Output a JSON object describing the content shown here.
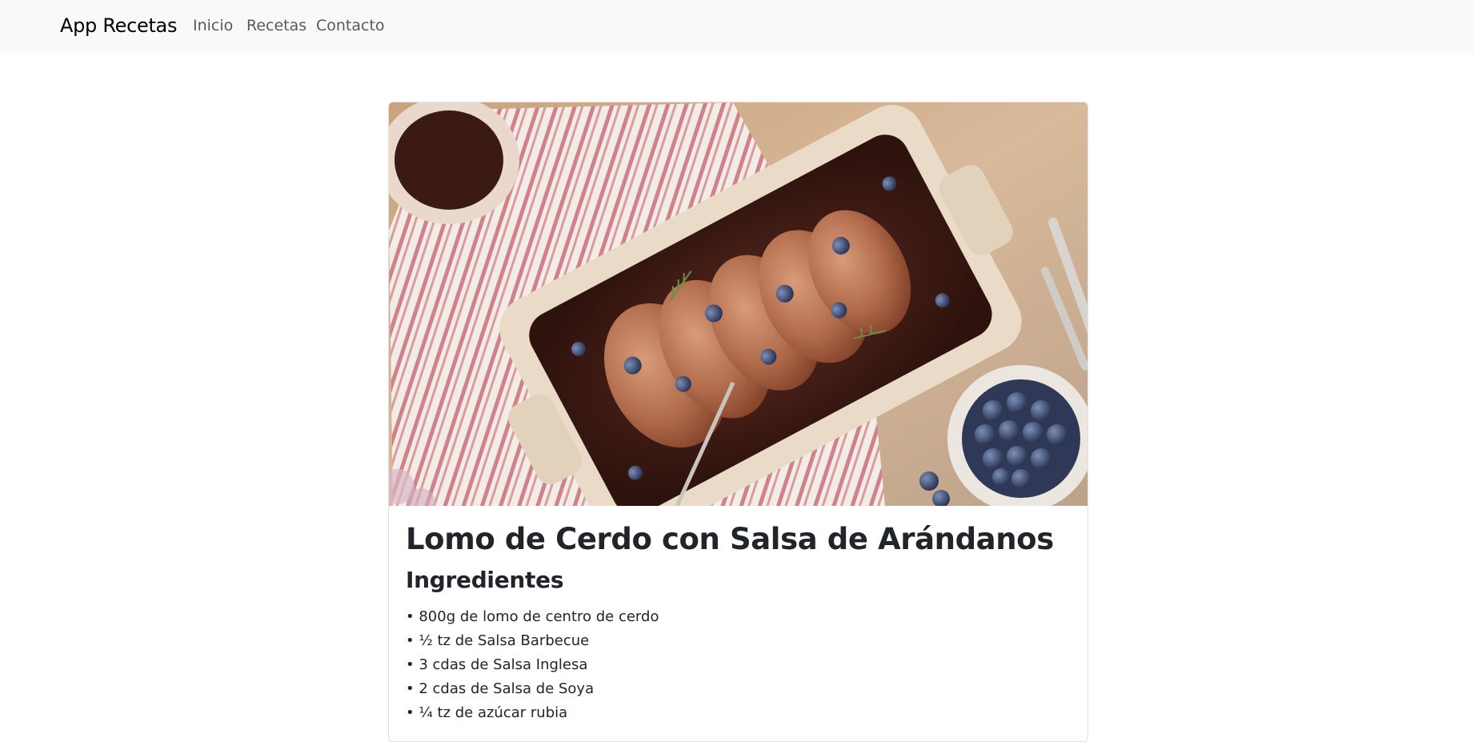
{
  "navbar": {
    "brand": "App Recetas",
    "links": [
      "Inicio",
      "Recetas",
      "Contacto"
    ]
  },
  "recipe": {
    "image_icon": "roasted-pork-loin-photo",
    "title": "Lomo de Cerdo con Salsa de Arándanos",
    "ingredients_heading": "Ingredientes",
    "ingredients": [
      "• 800g de lomo de centro de cerdo",
      "• ½ tz de Salsa Barbecue",
      "• 3 cdas de Salsa Inglesa",
      "• 2 cdas de Salsa de Soya",
      "• ¼ tz de azúcar rubia"
    ]
  },
  "colors": {
    "navbar_bg": "#f8f9fa",
    "text": "#212529",
    "link": "#6c6f72"
  }
}
